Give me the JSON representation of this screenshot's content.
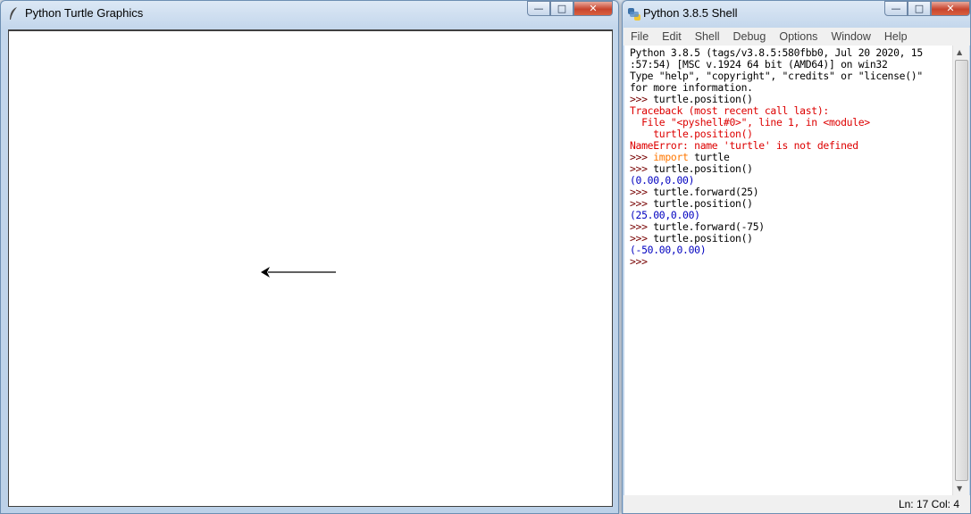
{
  "turtle_window": {
    "title": "Python Turtle Graphics",
    "icon": "feather-icon",
    "controls": {
      "minimize": "—",
      "maximize": "□",
      "close": "✕"
    }
  },
  "shell_window": {
    "title": "Python 3.8.5 Shell",
    "icon": "python-icon",
    "controls": {
      "minimize": "—",
      "maximize": "□",
      "close": "✕"
    },
    "menu": [
      "File",
      "Edit",
      "Shell",
      "Debug",
      "Options",
      "Window",
      "Help"
    ],
    "lines": [
      {
        "text": "Python 3.8.5 (tags/v3.8.5:580fbb0, Jul 20 2020, 15",
        "color": "black"
      },
      {
        "text": ":57:54) [MSC v.1924 64 bit (AMD64)] on win32",
        "color": "black"
      },
      {
        "text": "Type \"help\", \"copyright\", \"credits\" or \"license()\"",
        "color": "black"
      },
      {
        "text": "for more information.",
        "color": "black"
      },
      {
        "prompt": ">>> ",
        "text": "turtle.position()",
        "color": "black"
      },
      {
        "text": "Traceback (most recent call last):",
        "color": "red"
      },
      {
        "text": "  File \"<pyshell#0>\", line 1, in <module>",
        "color": "red"
      },
      {
        "text": "    turtle.position()",
        "color": "red"
      },
      {
        "text": "NameError: name 'turtle' is not defined",
        "color": "red"
      },
      {
        "prompt": ">>> ",
        "keyword": "import",
        "text": " turtle",
        "color": "black"
      },
      {
        "prompt": ">>> ",
        "text": "turtle.position()",
        "color": "black"
      },
      {
        "text": "(0.00,0.00)",
        "color": "blue"
      },
      {
        "prompt": ">>> ",
        "text": "turtle.forward(25)",
        "color": "black"
      },
      {
        "prompt": ">>> ",
        "text": "turtle.position()",
        "color": "black"
      },
      {
        "text": "(25.00,0.00)",
        "color": "blue"
      },
      {
        "prompt": ">>> ",
        "text": "turtle.forward(-75)",
        "color": "black"
      },
      {
        "prompt": ">>> ",
        "text": "turtle.position()",
        "color": "black"
      },
      {
        "text": "(-50.00,0.00)",
        "color": "blue"
      },
      {
        "prompt": ">>> ",
        "text": "",
        "color": "black"
      }
    ],
    "status": "Ln: 17   Col: 4"
  },
  "colors": {
    "output": "#0000c0",
    "error": "#dd0000",
    "keyword": "#ff7700",
    "prompt": "#770000"
  }
}
